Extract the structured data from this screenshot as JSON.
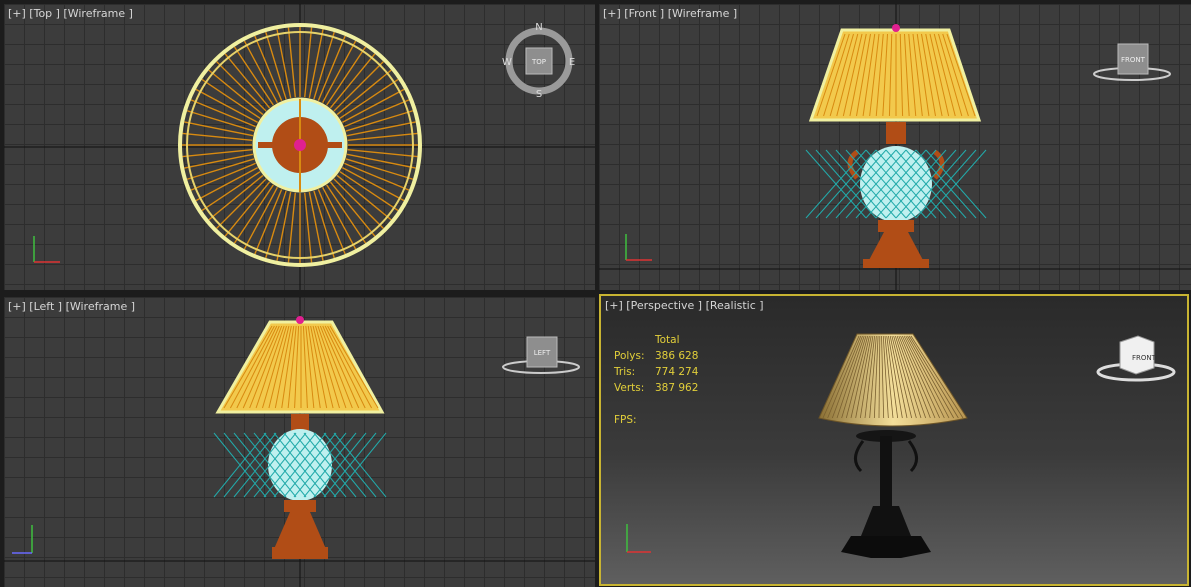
{
  "viewports": {
    "top": {
      "label": "[+] [Top ] [Wireframe ]",
      "compass": {
        "n": "N",
        "s": "S",
        "e": "E",
        "w": "W",
        "cube": "TOP"
      }
    },
    "front": {
      "label": "[+] [Front ] [Wireframe ]",
      "cube": "FRONT"
    },
    "left": {
      "label": "[+] [Left ] [Wireframe ]",
      "cube": "LEFT"
    },
    "perspective": {
      "label": "[+] [Perspective ] [Realistic ]",
      "cube": "FRONT",
      "stats": {
        "header": "Total",
        "polys_label": "Polys:",
        "polys": "386 628",
        "tris_label": "Tris:",
        "tris": "774 274",
        "verts_label": "Verts:",
        "verts": "387 962",
        "fps_label": "FPS:"
      }
    }
  },
  "colors": {
    "viewport_bg": "#3c3c3c",
    "grid": "#2d2d2d",
    "active_border": "#c8b432",
    "shade": "#f2c94c",
    "wire": "#d88a10",
    "base": "#b14d16",
    "glass": "#bff0ef",
    "pivot": "#e02090",
    "stats_text": "#e2cf3a"
  },
  "icons": [
    "viewcube-icon",
    "compass-icon",
    "axis-gizmo-icon",
    "lamp-model"
  ]
}
